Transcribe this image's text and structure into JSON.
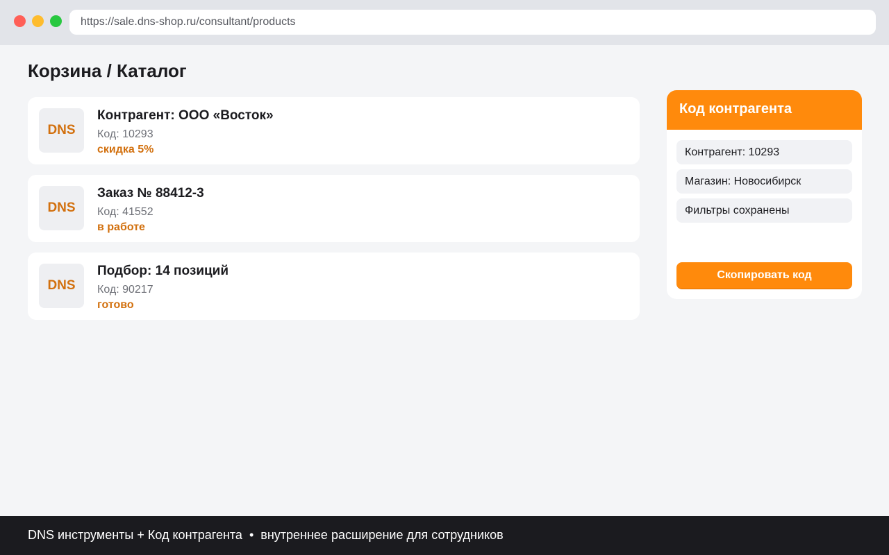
{
  "browser": {
    "url": "https://sale.dns-shop.ru/consultant/products"
  },
  "page": {
    "title": "Корзина / Каталог"
  },
  "cards": [
    {
      "logo": "DNS",
      "title": "Контрагент: ООО «Восток»",
      "code": "Код: 10293",
      "status": "скидка 5%"
    },
    {
      "logo": "DNS",
      "title": "Заказ № 88412-3",
      "code": "Код: 41552",
      "status": "в работе"
    },
    {
      "logo": "DNS",
      "title": "Подбор: 14 позиций",
      "code": "Код: 90217",
      "status": "готово"
    }
  ],
  "panel": {
    "title": "Код контрагента",
    "rows": [
      "Контрагент: 10293",
      "Магазин: Новосибирск",
      "Фильтры сохранены"
    ],
    "copy_label": "Скопировать код"
  },
  "footer": {
    "left": "DNS инструменты + Код контрагента",
    "separator": "•",
    "right": "внутреннее расширение для сотрудников"
  },
  "colors": {
    "accent": "#ff8a0c",
    "status_text": "#d2700e",
    "footer_bg": "#1b1b1f"
  }
}
